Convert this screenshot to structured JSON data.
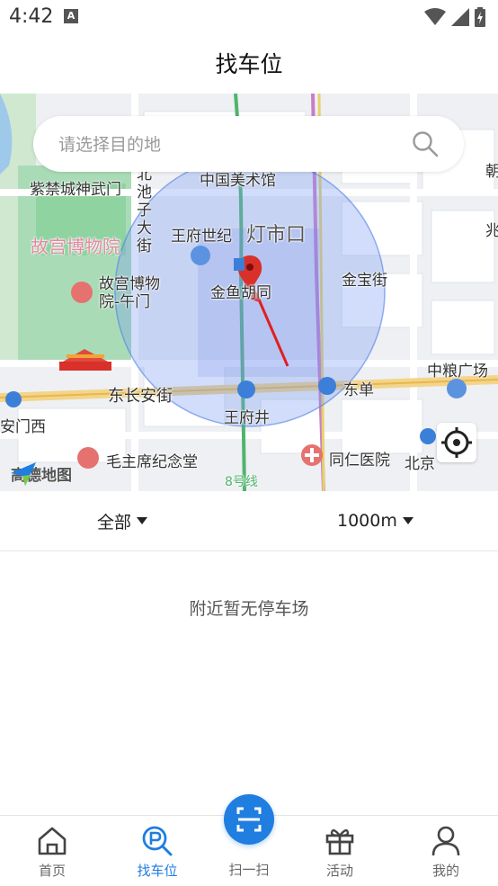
{
  "status_bar": {
    "time": "4:42",
    "notification_icon": "a-icon"
  },
  "header": {
    "title": "找车位"
  },
  "search": {
    "placeholder": "请选择目的地"
  },
  "map": {
    "labels": {
      "palace_gate": "紫禁城神武门",
      "palace_museum": "故宫博物院",
      "palace_museum_wumen": "故宫博物\n院-午门",
      "beichizi": "北\n池\n子\n大\n街",
      "wangfu_world": "王府世纪",
      "dengshikou": "灯市口",
      "jinyu": "金鱼胡同",
      "jinbao": "金宝街",
      "zhongguo": "中国美术馆",
      "dongchang": "东长安街",
      "wangfujing": "王府井",
      "dongdan": "东单",
      "zhongliang": "中粮广场",
      "tiananmen_west": "安门西",
      "mausoleum": "毛主席纪念堂",
      "tongren": "同仁医院",
      "beijing": "北京",
      "line8": "8号线",
      "zhao": "朝",
      "zhao2": "兆"
    },
    "provider": "高德地图"
  },
  "filters": {
    "type": "全部",
    "distance": "1000m"
  },
  "empty_message": "附近暂无停车场",
  "tabs": [
    {
      "label": "首页",
      "icon": "home-icon"
    },
    {
      "label": "找车位",
      "icon": "parking-search-icon",
      "active": true
    },
    {
      "label": "扫一扫",
      "icon": "scan-icon"
    },
    {
      "label": "活动",
      "icon": "gift-icon"
    },
    {
      "label": "我的",
      "icon": "user-icon"
    }
  ],
  "colors": {
    "accent": "#1f7ee0",
    "pin": "#d9302a"
  }
}
